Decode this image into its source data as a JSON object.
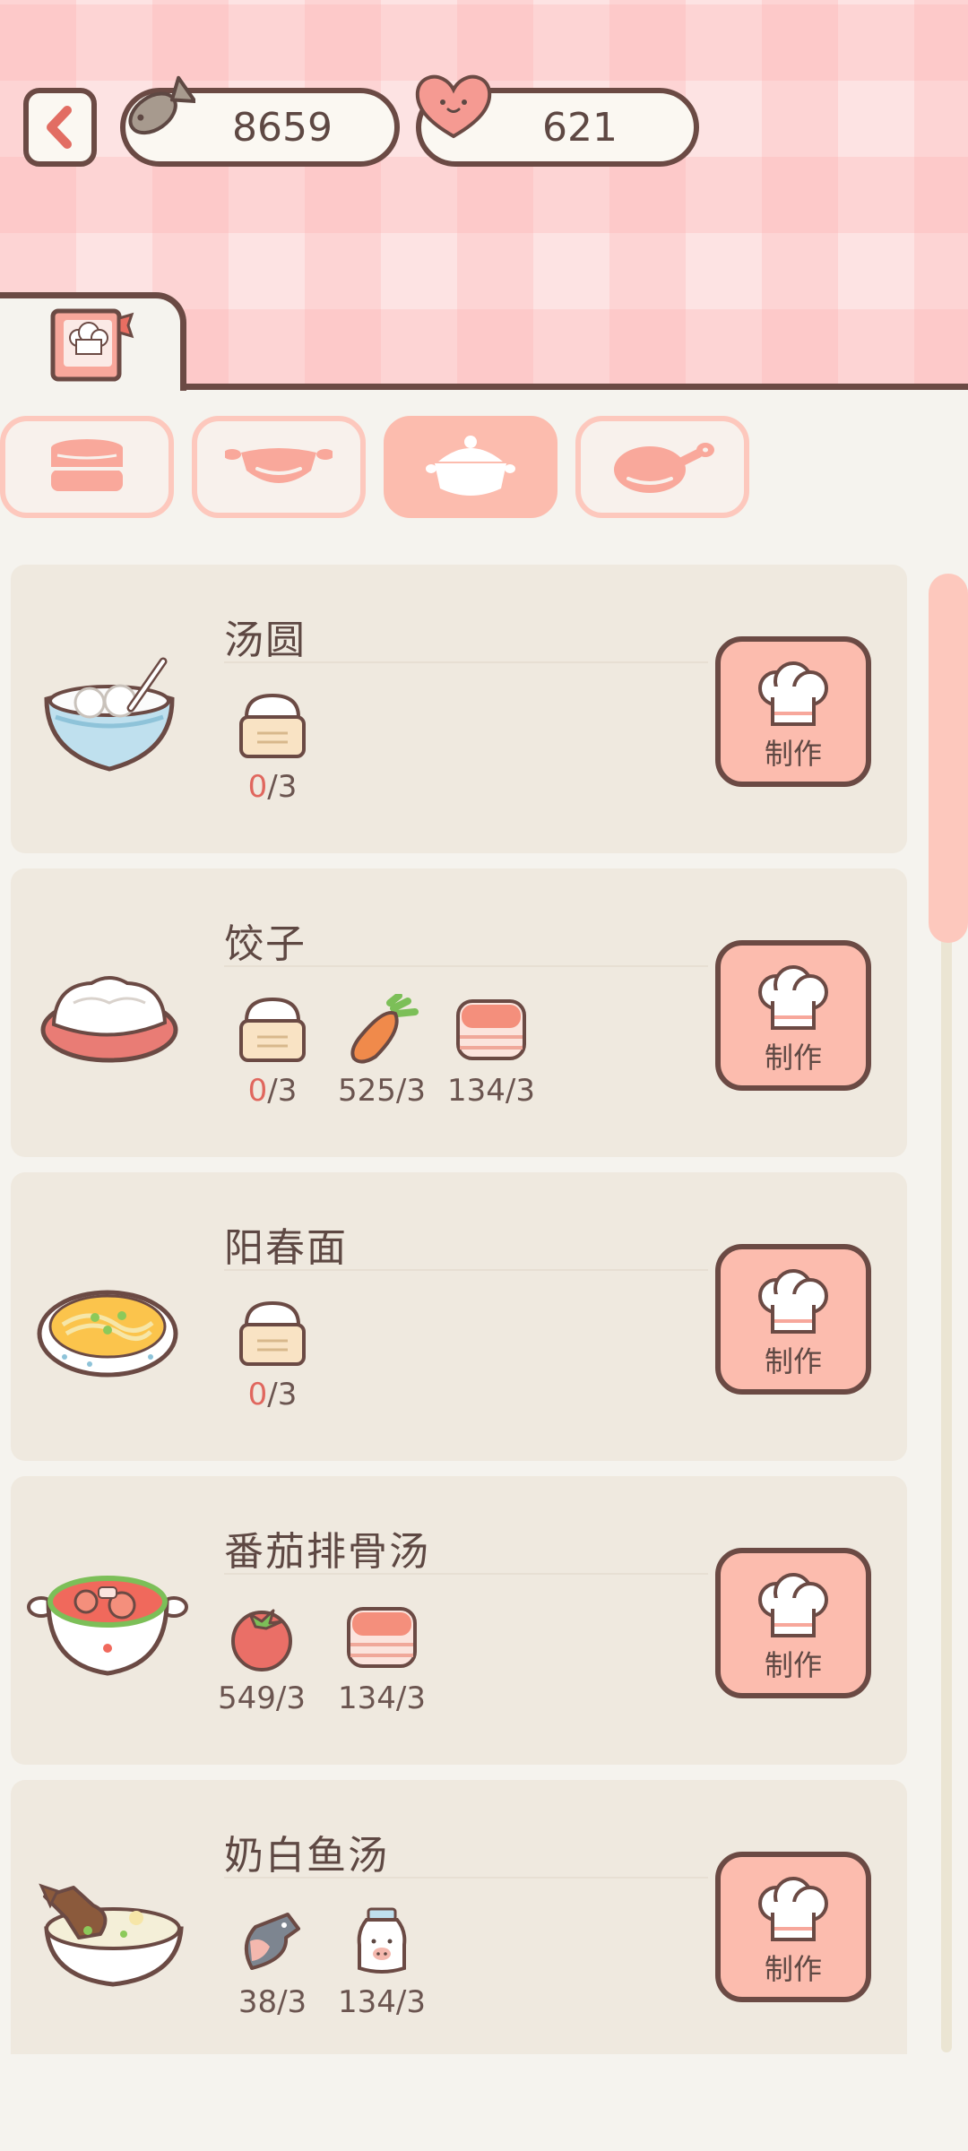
{
  "header": {
    "fish_currency": "8659",
    "heart_currency": "621"
  },
  "tab_icon": "recipe-book-icon",
  "categories": [
    {
      "icon": "steamer-icon",
      "active": false
    },
    {
      "icon": "wok-icon",
      "active": false
    },
    {
      "icon": "pot-icon",
      "active": true
    },
    {
      "icon": "frying-pan-icon",
      "active": false
    }
  ],
  "recipes": [
    {
      "name": "汤圆",
      "dish_icon": "tangyuan-bowl-icon",
      "ingredients": [
        {
          "icon": "flour-icon",
          "have": "0",
          "need": "/3",
          "short": true
        }
      ],
      "button": "制作"
    },
    {
      "name": "饺子",
      "dish_icon": "dumplings-plate-icon",
      "ingredients": [
        {
          "icon": "flour-icon",
          "have": "0",
          "need": "/3",
          "short": true
        },
        {
          "icon": "carrot-icon",
          "have": "525",
          "need": "/3",
          "short": false
        },
        {
          "icon": "meat-icon",
          "have": "134",
          "need": "/3",
          "short": false
        }
      ],
      "button": "制作"
    },
    {
      "name": "阳春面",
      "dish_icon": "noodle-bowl-icon",
      "ingredients": [
        {
          "icon": "flour-icon",
          "have": "0",
          "need": "/3",
          "short": true
        }
      ],
      "button": "制作"
    },
    {
      "name": "番茄排骨汤",
      "dish_icon": "tomato-rib-soup-icon",
      "ingredients": [
        {
          "icon": "tomato-icon",
          "have": "549",
          "need": "/3",
          "short": false
        },
        {
          "icon": "meat-icon",
          "have": "134",
          "need": "/3",
          "short": false
        }
      ],
      "button": "制作"
    },
    {
      "name": "奶白鱼汤",
      "dish_icon": "fish-soup-icon",
      "ingredients": [
        {
          "icon": "fish-icon",
          "have": "38",
          "need": "/3",
          "short": false
        },
        {
          "icon": "milk-icon",
          "have": "134",
          "need": "/3",
          "short": false
        }
      ],
      "button": "制作"
    }
  ],
  "colors": {
    "accent": "#fcbcae",
    "outline": "#6b4a44",
    "card": "#efe9df",
    "shortage": "#e0675e"
  }
}
